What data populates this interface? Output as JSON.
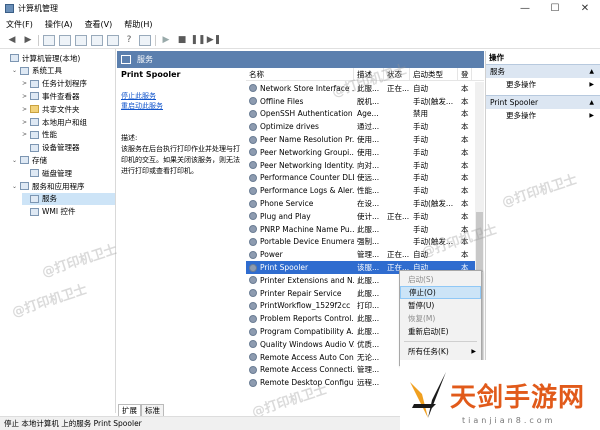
{
  "window": {
    "title": "计算机管理",
    "minimize": "—",
    "maximize": "☐",
    "close": "✕"
  },
  "menu": [
    "文件(F)",
    "操作(A)",
    "查看(V)",
    "帮助(H)"
  ],
  "tree": [
    {
      "label": "计算机管理(本地)",
      "indent": 0,
      "arrow": "",
      "folder": false
    },
    {
      "label": "系统工具",
      "indent": 1,
      "arrow": "⌄",
      "folder": false
    },
    {
      "label": "任务计划程序",
      "indent": 2,
      "arrow": ">",
      "folder": false
    },
    {
      "label": "事件查看器",
      "indent": 2,
      "arrow": ">",
      "folder": false
    },
    {
      "label": "共享文件夹",
      "indent": 2,
      "arrow": ">",
      "folder": true
    },
    {
      "label": "本地用户和组",
      "indent": 2,
      "arrow": ">",
      "folder": false
    },
    {
      "label": "性能",
      "indent": 2,
      "arrow": ">",
      "folder": false
    },
    {
      "label": "设备管理器",
      "indent": 2,
      "arrow": "",
      "folder": false
    },
    {
      "label": "存储",
      "indent": 1,
      "arrow": "⌄",
      "folder": false
    },
    {
      "label": "磁盘管理",
      "indent": 2,
      "arrow": "",
      "folder": false
    },
    {
      "label": "服务和应用程序",
      "indent": 1,
      "arrow": "⌄",
      "folder": false
    },
    {
      "label": "服务",
      "indent": 2,
      "arrow": "",
      "folder": false,
      "selected": true
    },
    {
      "label": "WMI 控件",
      "indent": 2,
      "arrow": "",
      "folder": false
    }
  ],
  "services_header": "服务",
  "detail": {
    "title": "Print Spooler",
    "stop_link": "停止此服务",
    "restart_link": "重启动此服务",
    "desc_label": "描述:",
    "desc_text": "该服务在后台执行打印作业并处理与打印机的交互。如果关闭该服务，则无法进行打印或查看打印机。"
  },
  "columns": [
    "名称",
    "描述",
    "状态",
    "启动类型",
    "登"
  ],
  "services": [
    {
      "name": "Network Store Interface ...",
      "desc": "此服...",
      "status": "正在...",
      "startup": "自动",
      "logon": "本"
    },
    {
      "name": "Offline Files",
      "desc": "脱机...",
      "status": "",
      "startup": "手动(触发...",
      "logon": "本"
    },
    {
      "name": "OpenSSH Authentication ...",
      "desc": "Age...",
      "status": "",
      "startup": "禁用",
      "logon": "本"
    },
    {
      "name": "Optimize drives",
      "desc": "通过...",
      "status": "",
      "startup": "手动",
      "logon": "本"
    },
    {
      "name": "Peer Name Resolution Pr...",
      "desc": "使用...",
      "status": "",
      "startup": "手动",
      "logon": "本"
    },
    {
      "name": "Peer Networking Groupi...",
      "desc": "使用...",
      "status": "",
      "startup": "手动",
      "logon": "本"
    },
    {
      "name": "Peer Networking Identity...",
      "desc": "向对...",
      "status": "",
      "startup": "手动",
      "logon": "本"
    },
    {
      "name": "Performance Counter DLL...",
      "desc": "使远...",
      "status": "",
      "startup": "手动",
      "logon": "本"
    },
    {
      "name": "Performance Logs & Aler...",
      "desc": "性能...",
      "status": "",
      "startup": "手动",
      "logon": "本"
    },
    {
      "name": "Phone Service",
      "desc": "在设...",
      "status": "",
      "startup": "手动(触发...",
      "logon": "本"
    },
    {
      "name": "Plug and Play",
      "desc": "使计...",
      "status": "正在...",
      "startup": "手动",
      "logon": "本"
    },
    {
      "name": "PNRP Machine Name Pu...",
      "desc": "此服...",
      "status": "",
      "startup": "手动",
      "logon": "本"
    },
    {
      "name": "Portable Device Enumera...",
      "desc": "强制...",
      "status": "",
      "startup": "手动(触发...",
      "logon": "本"
    },
    {
      "name": "Power",
      "desc": "管理...",
      "status": "正在...",
      "startup": "自动",
      "logon": "本"
    },
    {
      "name": "Print Spooler",
      "desc": "该服...",
      "status": "正在...",
      "startup": "自动",
      "logon": "本",
      "selected": true
    },
    {
      "name": "Printer Extensions and N...",
      "desc": "此服...",
      "status": "",
      "startup": "",
      "logon": ""
    },
    {
      "name": "Printer Repair Service",
      "desc": "此服...",
      "status": "",
      "startup": "",
      "logon": ""
    },
    {
      "name": "PrintWorkflow_1529f2cc",
      "desc": "打印...",
      "status": "",
      "startup": "",
      "logon": ""
    },
    {
      "name": "Problem Reports Control...",
      "desc": "此服...",
      "status": "",
      "startup": "",
      "logon": ""
    },
    {
      "name": "Program Compatibility A...",
      "desc": "此服...",
      "status": "",
      "startup": "",
      "logon": ""
    },
    {
      "name": "Quality Windows Audio V...",
      "desc": "优质...",
      "status": "",
      "startup": "",
      "logon": ""
    },
    {
      "name": "Remote Access Auto Con...",
      "desc": "无论...",
      "status": "",
      "startup": "",
      "logon": ""
    },
    {
      "name": "Remote Access Connecti...",
      "desc": "管理...",
      "status": "",
      "startup": "",
      "logon": ""
    },
    {
      "name": "Remote Desktop Configu...",
      "desc": "远程...",
      "status": "",
      "startup": "",
      "logon": ""
    }
  ],
  "context_menu": [
    {
      "label": "启动(S)",
      "disabled": true
    },
    {
      "label": "停止(O)",
      "highlighted": true
    },
    {
      "label": "暂停(U)"
    },
    {
      "label": "恢复(M)",
      "disabled": true
    },
    {
      "label": "重新启动(E)"
    },
    {
      "sep": true
    },
    {
      "label": "所有任务(K)",
      "submenu": true
    },
    {
      "sep": true
    },
    {
      "label": "刷新(F)"
    }
  ],
  "actions": {
    "header": "操作",
    "section1": "服务",
    "more1": "更多操作",
    "section2": "Print Spooler",
    "more2": "更多操作"
  },
  "tabs": [
    "扩展",
    "标准"
  ],
  "status_bar": "停止 本地计算机 上的服务 Print Spooler",
  "watermark": "@打印机卫士",
  "brand": {
    "name": "天剑手游网",
    "url": "tianjian8.com"
  }
}
